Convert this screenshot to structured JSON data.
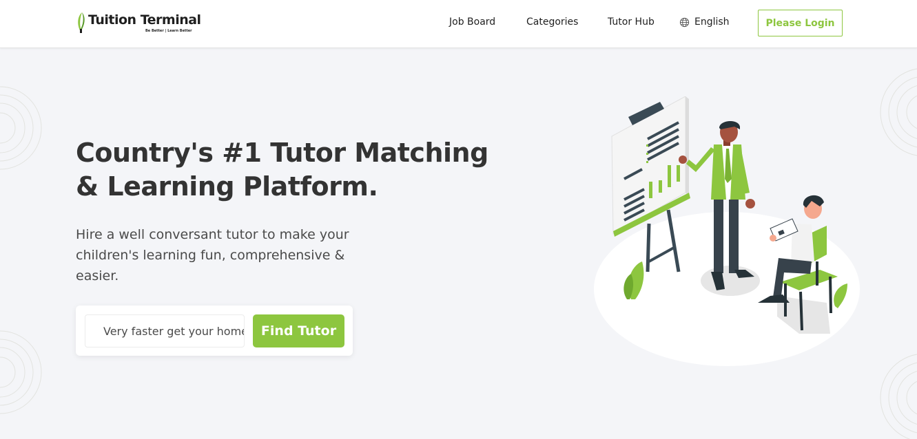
{
  "brand": {
    "name": "Tuition Terminal",
    "tagline": "Be Better | Learn Better",
    "accent": "#8dc63f"
  },
  "nav": {
    "items": [
      {
        "label": "Job Board"
      },
      {
        "label": "Categories"
      },
      {
        "label": "Tutor Hub"
      }
    ],
    "language": {
      "label": "English",
      "icon": "globe-icon"
    },
    "login_label": "Please Login"
  },
  "hero": {
    "title_line1": "Country's #1 Tutor Matching",
    "title_line2": "& Learning Platform.",
    "subtitle": "Hire a well conversant tutor to make your children's learning fun, comprehensive & easier.",
    "search_placeholder": "Very faster get your home tutor",
    "cta_label": "Find Tutor"
  },
  "colors": {
    "background": "#f4f5f8",
    "text": "#333333",
    "accent": "#8dc63f"
  }
}
